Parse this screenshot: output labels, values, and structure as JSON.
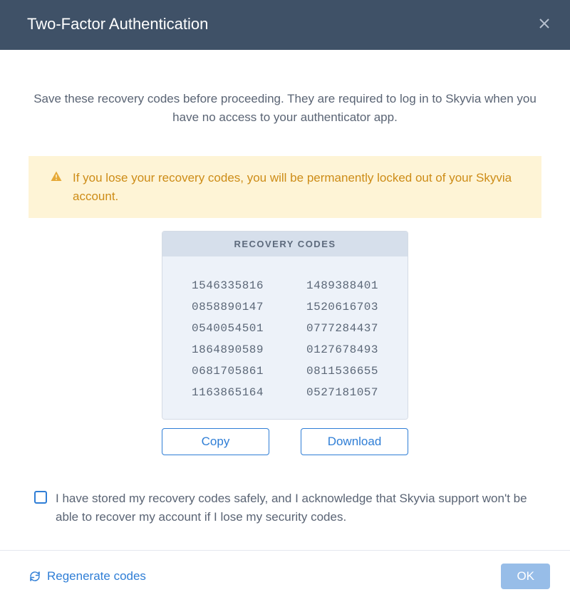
{
  "header": {
    "title": "Two-Factor Authentication"
  },
  "intro": "Save these recovery codes before proceeding. They are required to log in to Skyvia when you have no access to your authenticator app.",
  "warning": "If you lose your recovery codes, you will be permanently locked out of your Skyvia account.",
  "codes_header": "RECOVERY CODES",
  "codes": [
    "1546335816",
    "1489388401",
    "0858890147",
    "1520616703",
    "0540054501",
    "0777284437",
    "1864890589",
    "0127678493",
    "0681705861",
    "0811536655",
    "1163865164",
    "0527181057"
  ],
  "actions": {
    "copy": "Copy",
    "download": "Download"
  },
  "ack_text": "I have stored my recovery codes safely, and I acknowledge that Skyvia support won't be able to recover my account if I lose my security codes.",
  "footer": {
    "regenerate": "Regenerate codes",
    "ok": "OK"
  }
}
